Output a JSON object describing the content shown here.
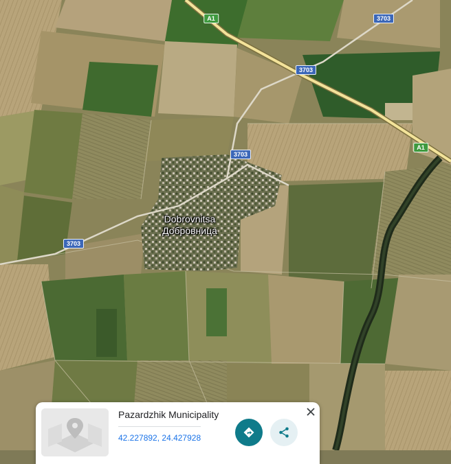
{
  "map": {
    "place_label_latin": "Dobrovnitsa",
    "place_label_cyrillic": "Добровница",
    "road_shields": [
      {
        "label": "A1",
        "type": "highway"
      },
      {
        "label": "A1",
        "type": "highway"
      },
      {
        "label": "3703",
        "type": "local"
      },
      {
        "label": "3703",
        "type": "local"
      },
      {
        "label": "3703",
        "type": "local"
      },
      {
        "label": "3703",
        "type": "local"
      }
    ]
  },
  "info_card": {
    "title": "Pazardzhik Municipality",
    "coordinates": "42.227892, 24.427928",
    "thumbnail_icon": "street-view-placeholder-icon",
    "directions_icon": "directions-icon",
    "share_icon": "share-icon",
    "close_icon": "close-icon"
  },
  "colors": {
    "directions_button": "#0f7b8a",
    "coordinates_link": "#1a73e8",
    "highway": "#f3e39a",
    "local_road": "#d9d2b3"
  }
}
